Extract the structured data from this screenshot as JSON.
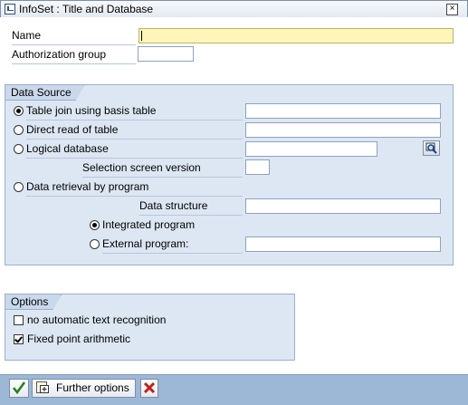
{
  "window": {
    "title": "InfoSet : Title and Database",
    "close_glyph": "×"
  },
  "header_fields": {
    "name_label": "Name",
    "name_value": "",
    "auth_label": "Authorization group",
    "auth_value": ""
  },
  "data_source": {
    "title": "Data Source",
    "options": [
      {
        "label": "Table join using basis table",
        "selected": true
      },
      {
        "label": "Direct read of table",
        "selected": false
      },
      {
        "label": "Logical database",
        "selected": false
      },
      {
        "label": "Data retrieval by program",
        "selected": false
      }
    ],
    "selection_screen_version_label": "Selection screen version",
    "data_structure_label": "Data structure",
    "program_options": [
      {
        "label": "Integrated program",
        "selected": true
      },
      {
        "label": "External program:",
        "selected": false
      }
    ]
  },
  "options_group": {
    "title": "Options",
    "checkboxes": [
      {
        "label": "no automatic text recognition",
        "checked": false
      },
      {
        "label": "Fixed point arithmetic",
        "checked": true
      }
    ]
  },
  "footer": {
    "further_options_label": "Further options"
  },
  "colors": {
    "accent_yellow": "#fff5b8",
    "group_bg": "#dce7f3",
    "footer_bg": "#9db7d6",
    "confirm_green": "#2f7d1d",
    "cancel_red": "#c0201b"
  },
  "icons": {
    "confirm": "checkmark-icon",
    "cancel": "cancel-x-icon",
    "search": "search-help-icon",
    "further": "details-icon"
  }
}
